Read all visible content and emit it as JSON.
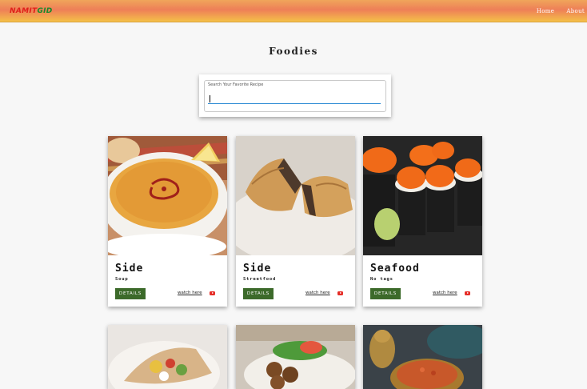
{
  "navbar": {
    "brand_part1": "NAMIT",
    "brand_part2": "GID",
    "links": [
      "Home",
      "About"
    ]
  },
  "page_title": "Foodies",
  "search": {
    "label": "Search Your Favorite Recipe",
    "value": ""
  },
  "cards": [
    {
      "title": "Side",
      "subtitle": "Soup",
      "button": "DETAILS",
      "link": "watch here"
    },
    {
      "title": "Side",
      "subtitle": "Streetfood",
      "button": "DETAILS",
      "link": "watch here"
    },
    {
      "title": "Seafood",
      "subtitle": "No tags",
      "button": "DETAILS",
      "link": "watch here"
    }
  ],
  "colors": {
    "details_button": "#3c6a2a",
    "search_underline": "#2a8ad4",
    "youtube": "#e52d27"
  }
}
